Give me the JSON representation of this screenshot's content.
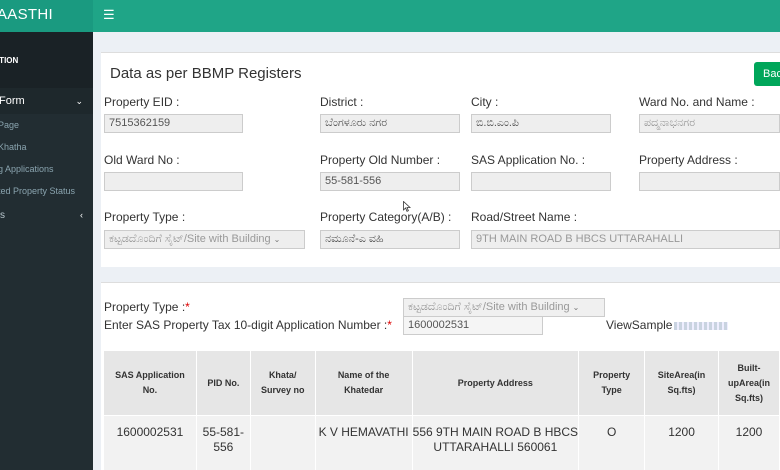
{
  "sidebar": {
    "brand": "AASTHI",
    "header": "ATION",
    "form_label": "Form",
    "sub_items": [
      "Page",
      "Khatha",
      "g Applications",
      "ted Property Status"
    ],
    "section": "s"
  },
  "card1": {
    "title": "Data as per BBMP Registers",
    "back_button": "Bac",
    "fields": {
      "property_eid": {
        "label": "Property EID :",
        "value": "7515362159"
      },
      "district": {
        "label": "District :",
        "value": "ಬೆಂಗಳೂರು ನಗರ"
      },
      "city": {
        "label": "City :",
        "value": "ಬಿ.ಬಿ.ಎಂ.ಪಿ"
      },
      "ward": {
        "label": "Ward No. and Name :",
        "value": "ಪದ್ಮನಾಭನಗರ"
      },
      "old_ward": {
        "label": "Old Ward No :",
        "value": ""
      },
      "old_number": {
        "label": "Property Old Number :",
        "value": "55-581-556"
      },
      "sas_app": {
        "label": "SAS Application No. :",
        "value": ""
      },
      "address": {
        "label": "Property Address :",
        "value": ""
      },
      "prop_type": {
        "label": "Property Type :",
        "value": "ಕಟ್ಟಡದೊಂದಿಗೆ ಸೈಟ್/Site with Building"
      },
      "category": {
        "label": "Property Category(A/B) :",
        "value": "ನಮೂನೆ-ಎ ವಹಿ"
      },
      "road": {
        "label": "Road/Street Name :",
        "value": "9TH MAIN ROAD B HBCS UTTARAHALLI"
      }
    }
  },
  "card2": {
    "prop_type_label": "Property Type :",
    "required_mark": "*",
    "prop_type_value": "ಕಟ್ಟಡದೊಂದಿಗೆ ಸೈಟ್/Site with Building",
    "sas_label": "Enter SAS Property Tax 10-digit Application Number :",
    "sas_value": "1600002531",
    "view_sample": "ViewSample"
  },
  "table": {
    "headers": [
      "SAS Application No.",
      "PID No.",
      "Khata/ Survey no",
      "Name of the Khatedar",
      "Property Address",
      "Property Type",
      "SiteArea(in Sq.fts)",
      "Built-upArea(in Sq.fts)"
    ],
    "rows": [
      [
        "1600002531",
        "55-581-556",
        "",
        "K V HEMAVATHI",
        "556 9TH MAIN ROAD B HBCS UTTARAHALLI 560061",
        "O",
        "1200",
        "1200"
      ]
    ]
  }
}
